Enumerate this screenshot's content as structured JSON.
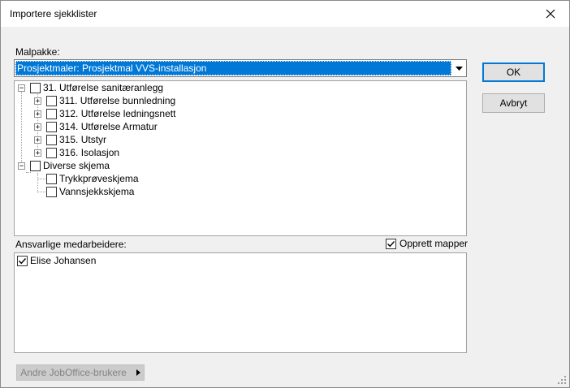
{
  "window": {
    "title": "Importere sjekklister",
    "close_glyph": "✕"
  },
  "template": {
    "label": "Malpakke:",
    "selected": "Prosjektmaler: Prosjektmal VVS-installasjon"
  },
  "tree": {
    "root": {
      "label": "31. Utførelse sanitæranlegg",
      "expanded": true,
      "checked": false
    },
    "root_children": [
      {
        "label": "311. Utførelse bunnledning",
        "expanded": false,
        "checked": false
      },
      {
        "label": "312. Utførelse ledningsnett",
        "expanded": false,
        "checked": false
      },
      {
        "label": "314. Utførelse Armatur",
        "expanded": false,
        "checked": false
      },
      {
        "label": "315. Utstyr",
        "expanded": false,
        "checked": false
      },
      {
        "label": "316. Isolasjon",
        "expanded": false,
        "checked": false
      }
    ],
    "misc": {
      "label": "Diverse skjema",
      "expanded": true,
      "checked": false
    },
    "misc_children": [
      {
        "label": "Trykkprøveskjema",
        "checked": false
      },
      {
        "label": "Vannsjekkskjema",
        "checked": false
      }
    ]
  },
  "responsible": {
    "label": "Ansvarlige medarbeidere:",
    "create_folders": {
      "label": "Opprett mapper",
      "checked": true
    },
    "people": [
      {
        "name": "Elise Johansen",
        "checked": true
      }
    ]
  },
  "buttons": {
    "ok": "OK",
    "cancel": "Avbryt",
    "other_users": "Andre JobOffice-brukere"
  },
  "colors": {
    "selection": "#0078d7",
    "default_button_border": "#0078d7"
  }
}
